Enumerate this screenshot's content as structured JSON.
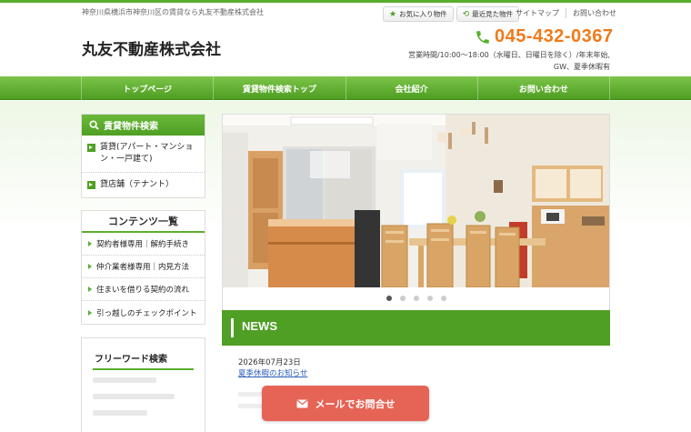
{
  "header": {
    "tagline": "神奈川県横浜市神奈川区の賃貸なら丸友不動産株式会社",
    "fav_button": "お気に入り物件",
    "recent_button": "最近見た物件",
    "links": [
      "サイトマップ",
      "お問い合わせ"
    ],
    "company": "丸友不動産株式会社",
    "phone": "045-432-0367",
    "hours_line1": "営業時間/10:00～18:00（水曜日、日曜日を除く）/年末年始,",
    "hours_line2": "GW、夏季休暇有"
  },
  "nav": {
    "items": [
      "トップページ",
      "賃貸物件検索トップ",
      "会社紹介",
      "お問い合わせ"
    ]
  },
  "sidebar": {
    "search_title": "賃貸物件検索",
    "search_items": [
      "賃貸(アパート・マンション・一戸建て)",
      "貸店舗（テナント）"
    ],
    "contents_title": "コンテンツ一覧",
    "contents_items": [
      "契約者様専用｜解約手続き",
      "仲介業者様専用｜内見方法",
      "住まいを借りる契約の流れ",
      "引っ越しのチェックポイント"
    ],
    "freeword_title": "フリーワード検索"
  },
  "slider": {
    "slide_count": 5,
    "active_index": 0
  },
  "news": {
    "title": "NEWS",
    "date": "2026年07月23日",
    "link": "夏季休暇のお知らせ"
  },
  "mail_button": "メールでお問合せ",
  "colors": {
    "brand_green": "#4f9f24",
    "phone_orange": "#ef7a1a",
    "mail_button": "#e66455"
  }
}
